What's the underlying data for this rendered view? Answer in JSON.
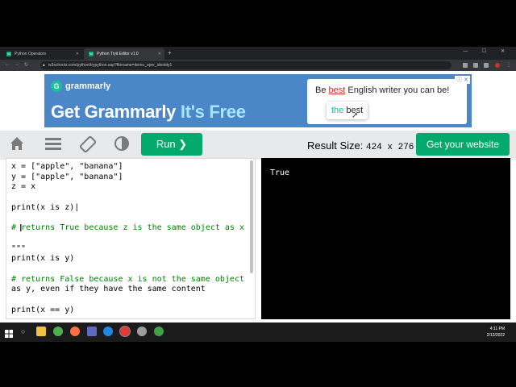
{
  "browser": {
    "tabs": [
      {
        "label": "Python Operators",
        "favicon": "W",
        "active": false
      },
      {
        "label": "Python Tryit Editor v1.0",
        "favicon": "W",
        "active": true
      }
    ],
    "new_tab": "+",
    "window_controls": "—  ☐  ✕",
    "url": "w3schools.com/python/trypython.asp?filename=demo_oper_identity1"
  },
  "ad": {
    "brand": "grammarly",
    "headline_main": "Get Grammarly ",
    "headline_accent": "It's Free",
    "card_prefix": "Be ",
    "card_strike": "best",
    "card_suffix": " English writer you can be!",
    "suggest_green": "the",
    "suggest_rest": " best",
    "info": "ⓘ ✕",
    "colors": {
      "background": "#4a86c8",
      "accent": "#15c39a"
    }
  },
  "toolbar": {
    "run_label": "Run ❯",
    "result_label": "Result Size: ",
    "result_dims": "424 x 276",
    "get_website_label": "Get your website",
    "icons": [
      "home-icon",
      "menu-icon",
      "rotate-icon",
      "contrast-icon"
    ],
    "colors": {
      "run": "#04aa6d",
      "bar": "#e7e9eb"
    }
  },
  "editor": {
    "lines": [
      {
        "text": "x = [\"apple\", \"banana\"]",
        "kind": "code"
      },
      {
        "text": "y = [\"apple\", \"banana\"]",
        "kind": "code"
      },
      {
        "text": "z = x",
        "kind": "code"
      },
      {
        "text": "",
        "kind": "code"
      },
      {
        "text": "print(x is z)|",
        "kind": "code"
      },
      {
        "text": "",
        "kind": "code"
      },
      {
        "text": "# returns True because z is the same object as x",
        "kind": "comment"
      },
      {
        "text": "",
        "kind": "code"
      },
      {
        "text": "\"\"\"",
        "kind": "code"
      },
      {
        "text": "print(x is y)",
        "kind": "code"
      },
      {
        "text": "",
        "kind": "code"
      },
      {
        "text": "# returns False because x is not the same object",
        "kind": "comment"
      },
      {
        "text": "as y, even if they have the same content",
        "kind": "code"
      },
      {
        "text": "",
        "kind": "code"
      },
      {
        "text": "print(x == y)",
        "kind": "code"
      }
    ]
  },
  "result": {
    "output": "True"
  },
  "taskbar": {
    "time": "4:11 PM",
    "date": "2/12/2022"
  }
}
